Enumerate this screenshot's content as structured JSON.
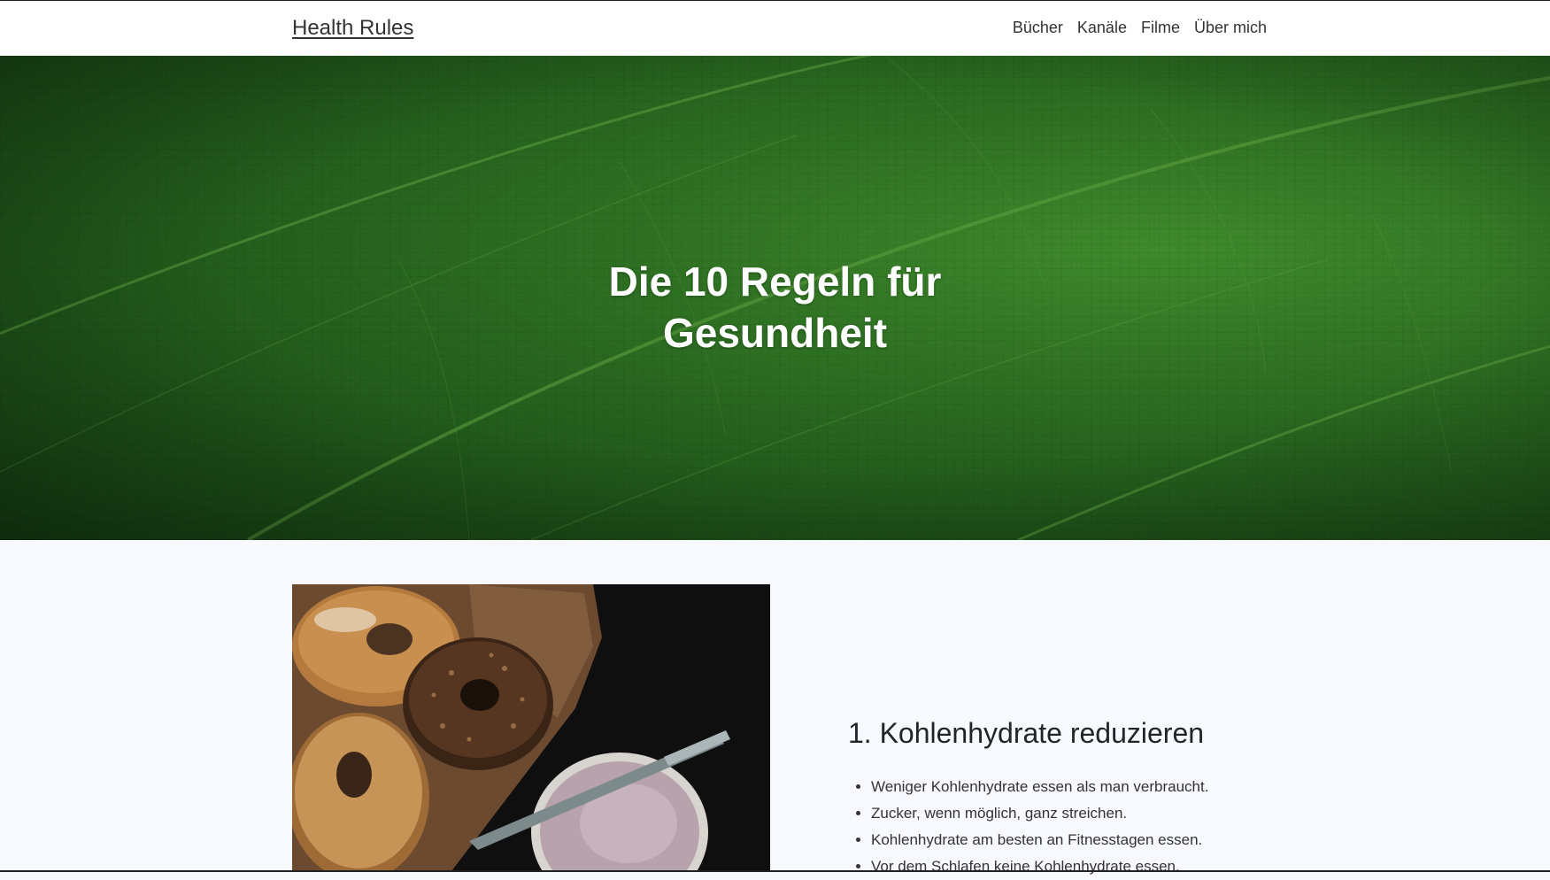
{
  "navbar": {
    "brand": "Health Rules",
    "links": [
      "Bücher",
      "Kanäle",
      "Filme",
      "Über mich"
    ]
  },
  "hero": {
    "title_line1": "Die 10 Regeln für",
    "title_line2": "Gesundheit"
  },
  "section": {
    "heading": "1. Kohlenhydrate reduzieren",
    "items": [
      "Weniger Kohlenhydrate essen als man verbraucht.",
      "Zucker, wenn möglich, ganz streichen.",
      "Kohlenhydrate am besten an Fitnesstagen essen.",
      "Vor dem Schlafen keine Kohlenhydrate essen."
    ]
  },
  "colors": {
    "background": "#f8f9fe",
    "hero_green": "#2d6e22",
    "text": "#212529"
  }
}
